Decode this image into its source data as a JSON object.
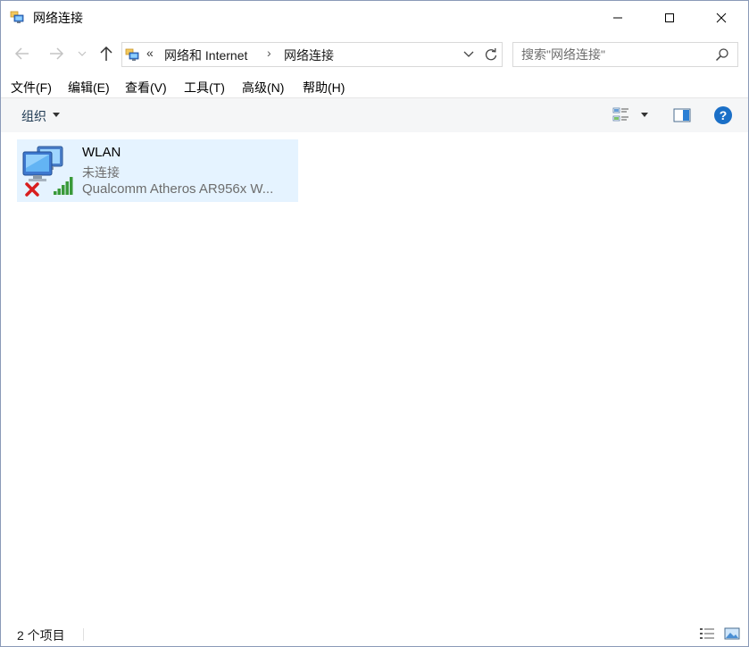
{
  "window": {
    "title": "网络连接",
    "icon": "network-connections-icon"
  },
  "titlebar": {
    "minimize_icon": "minimize-icon",
    "maximize_icon": "maximize-icon",
    "close_icon": "close-icon"
  },
  "address": {
    "overflow": "«",
    "breadcrumbs": [
      "网络和 Internet",
      "网络连接"
    ],
    "separator": "›"
  },
  "search": {
    "placeholder": "搜索\"网络连接\""
  },
  "menu": [
    {
      "label": "文件(F)"
    },
    {
      "label": "编辑(E)"
    },
    {
      "label": "查看(V)"
    },
    {
      "label": "工具(T)"
    },
    {
      "label": "高级(N)"
    },
    {
      "label": "帮助(H)"
    }
  ],
  "command_bar": {
    "organize_label": "组织",
    "help_icon": "help-icon"
  },
  "items": [
    {
      "name": "WLAN",
      "status": "未连接",
      "device": "Qualcomm Atheros AR956x W...",
      "icon": "wifi-disconnected-icon"
    }
  ],
  "status_bar": {
    "count": "2 个项目"
  },
  "colors": {
    "selection": "#e5f3ff",
    "help_blue": "#1a6fc7",
    "error_red": "#d81e1e",
    "signal_green": "#3a9a3a"
  }
}
